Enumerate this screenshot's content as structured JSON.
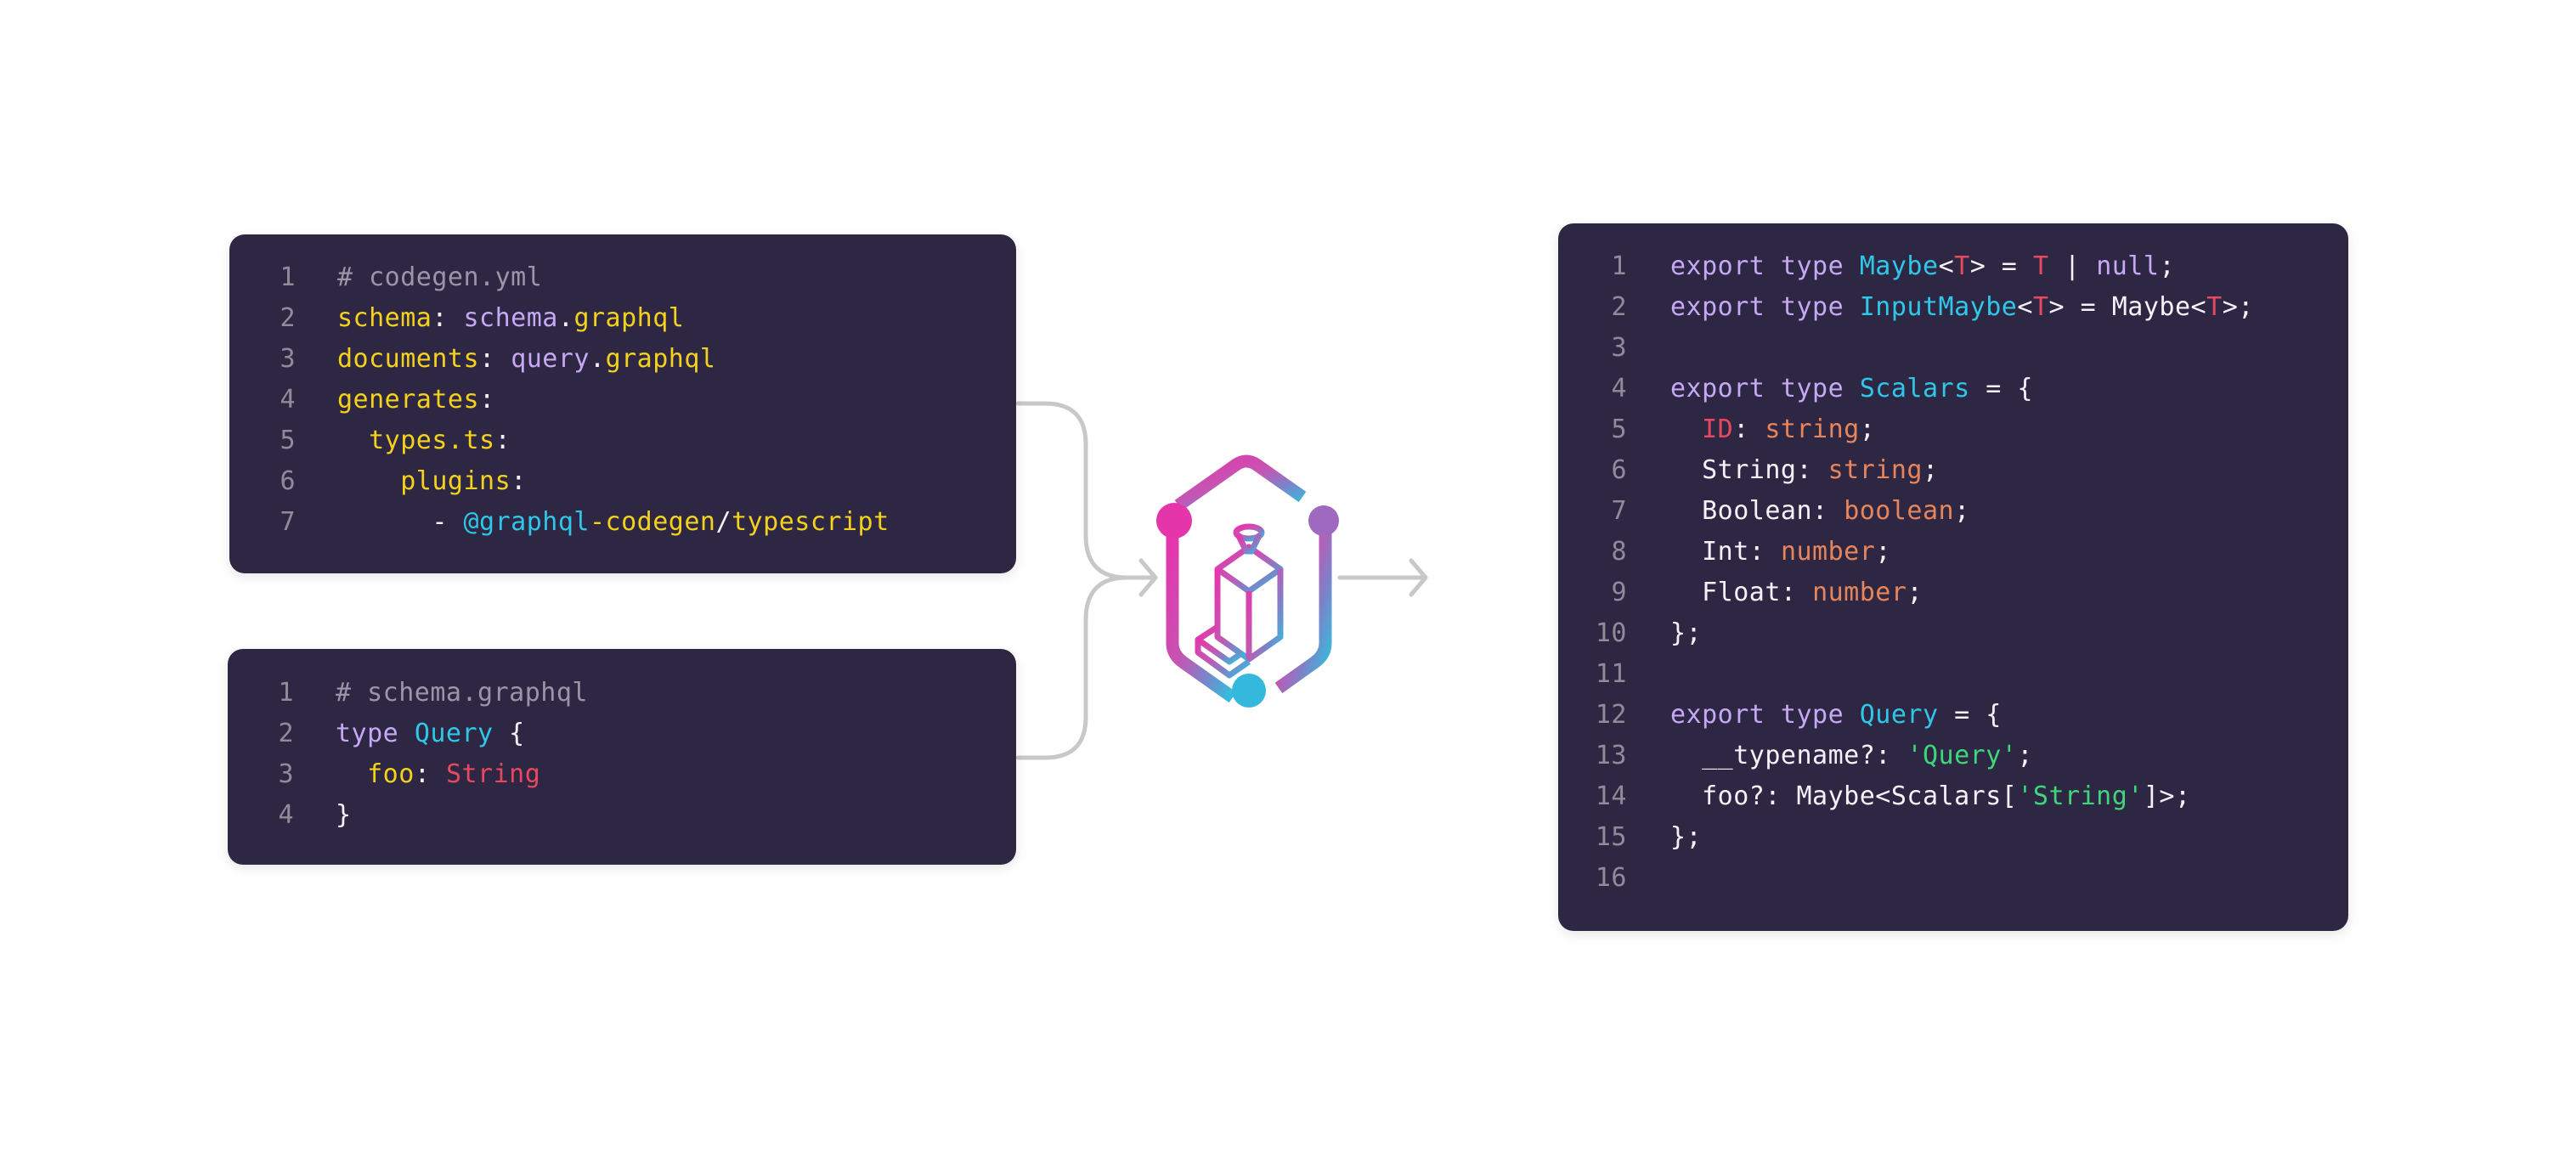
{
  "colors": {
    "panel_bg": "#2e2744",
    "line_number": "#8f8c99",
    "comment": "#9a96a8",
    "yaml_key": "#f4d21c",
    "keyword": "#c6a8f4",
    "type_name": "#2fc7e8",
    "scalar_red": "#e8485f",
    "ts_primitive": "#e8845a",
    "string_literal": "#3ed67a",
    "plain": "#f4f2f8",
    "connector": "#c8c8c8",
    "logo_pink": "#e535ab",
    "logo_purple": "#9f69c0",
    "logo_cyan": "#2ec2e0"
  },
  "panels": {
    "codegen_config": {
      "lines": [
        {
          "n": "1",
          "tokens": [
            {
              "t": "# codegen.yml",
              "c": "comment"
            }
          ]
        },
        {
          "n": "2",
          "tokens": [
            {
              "t": "schema",
              "c": "key"
            },
            {
              "t": ": ",
              "c": "white"
            },
            {
              "t": "schema",
              "c": "purple"
            },
            {
              "t": ".",
              "c": "white"
            },
            {
              "t": "graphql",
              "c": "yellow"
            }
          ]
        },
        {
          "n": "3",
          "tokens": [
            {
              "t": "documents",
              "c": "key"
            },
            {
              "t": ": ",
              "c": "white"
            },
            {
              "t": "query",
              "c": "purple"
            },
            {
              "t": ".",
              "c": "white"
            },
            {
              "t": "graphql",
              "c": "yellow"
            }
          ]
        },
        {
          "n": "4",
          "tokens": [
            {
              "t": "generates",
              "c": "key"
            },
            {
              "t": ":",
              "c": "white"
            }
          ]
        },
        {
          "n": "5",
          "tokens": [
            {
              "t": "  types.ts",
              "c": "key"
            },
            {
              "t": ":",
              "c": "white"
            }
          ]
        },
        {
          "n": "6",
          "tokens": [
            {
              "t": "    plugins",
              "c": "key"
            },
            {
              "t": ":",
              "c": "white"
            }
          ]
        },
        {
          "n": "7",
          "tokens": [
            {
              "t": "      - ",
              "c": "white"
            },
            {
              "t": "@graphql",
              "c": "cyan"
            },
            {
              "t": "-codegen",
              "c": "yellow"
            },
            {
              "t": "/",
              "c": "white"
            },
            {
              "t": "typescript",
              "c": "yellow"
            }
          ]
        }
      ]
    },
    "schema": {
      "lines": [
        {
          "n": "1",
          "tokens": [
            {
              "t": "# schema.graphql",
              "c": "comment"
            }
          ]
        },
        {
          "n": "2",
          "tokens": [
            {
              "t": "type ",
              "c": "purple"
            },
            {
              "t": "Query",
              "c": "cyan"
            },
            {
              "t": " {",
              "c": "white"
            }
          ]
        },
        {
          "n": "3",
          "tokens": [
            {
              "t": "  foo",
              "c": "key"
            },
            {
              "t": ": ",
              "c": "white"
            },
            {
              "t": "String",
              "c": "red"
            }
          ]
        },
        {
          "n": "4",
          "tokens": [
            {
              "t": "}",
              "c": "white"
            }
          ]
        }
      ]
    },
    "output_types": {
      "lines": [
        {
          "n": "1",
          "tokens": [
            {
              "t": "export type ",
              "c": "purple"
            },
            {
              "t": "Maybe",
              "c": "cyan"
            },
            {
              "t": "<",
              "c": "white"
            },
            {
              "t": "T",
              "c": "red"
            },
            {
              "t": "> = ",
              "c": "white"
            },
            {
              "t": "T",
              "c": "red"
            },
            {
              "t": " | ",
              "c": "white"
            },
            {
              "t": "null",
              "c": "purple"
            },
            {
              "t": ";",
              "c": "white"
            }
          ]
        },
        {
          "n": "2",
          "tokens": [
            {
              "t": "export type ",
              "c": "purple"
            },
            {
              "t": "InputMaybe",
              "c": "cyan"
            },
            {
              "t": "<",
              "c": "white"
            },
            {
              "t": "T",
              "c": "red"
            },
            {
              "t": "> = Maybe<",
              "c": "white"
            },
            {
              "t": "T",
              "c": "red"
            },
            {
              "t": ">;",
              "c": "white"
            }
          ]
        },
        {
          "n": "3",
          "tokens": []
        },
        {
          "n": "4",
          "tokens": [
            {
              "t": "export type ",
              "c": "purple"
            },
            {
              "t": "Scalars",
              "c": "cyan"
            },
            {
              "t": " = {",
              "c": "white"
            }
          ]
        },
        {
          "n": "5",
          "tokens": [
            {
              "t": "  ",
              "c": "white"
            },
            {
              "t": "ID",
              "c": "red"
            },
            {
              "t": ": ",
              "c": "white"
            },
            {
              "t": "string",
              "c": "orange"
            },
            {
              "t": ";",
              "c": "white"
            }
          ]
        },
        {
          "n": "6",
          "tokens": [
            {
              "t": "  String: ",
              "c": "white"
            },
            {
              "t": "string",
              "c": "orange"
            },
            {
              "t": ";",
              "c": "white"
            }
          ]
        },
        {
          "n": "7",
          "tokens": [
            {
              "t": "  Boolean: ",
              "c": "white"
            },
            {
              "t": "boolean",
              "c": "orange"
            },
            {
              "t": ";",
              "c": "white"
            }
          ]
        },
        {
          "n": "8",
          "tokens": [
            {
              "t": "  Int: ",
              "c": "white"
            },
            {
              "t": "number",
              "c": "orange"
            },
            {
              "t": ";",
              "c": "white"
            }
          ]
        },
        {
          "n": "9",
          "tokens": [
            {
              "t": "  Float: ",
              "c": "white"
            },
            {
              "t": "number",
              "c": "orange"
            },
            {
              "t": ";",
              "c": "white"
            }
          ]
        },
        {
          "n": "10",
          "tokens": [
            {
              "t": "};",
              "c": "white"
            }
          ]
        },
        {
          "n": "11",
          "tokens": []
        },
        {
          "n": "12",
          "tokens": [
            {
              "t": "export type ",
              "c": "purple"
            },
            {
              "t": "Query",
              "c": "cyan"
            },
            {
              "t": " = {",
              "c": "white"
            }
          ]
        },
        {
          "n": "13",
          "tokens": [
            {
              "t": "  __typename?: ",
              "c": "white"
            },
            {
              "t": "'Query'",
              "c": "green"
            },
            {
              "t": ";",
              "c": "white"
            }
          ]
        },
        {
          "n": "14",
          "tokens": [
            {
              "t": "  foo?: Maybe<Scalars[",
              "c": "white"
            },
            {
              "t": "'String'",
              "c": "green"
            },
            {
              "t": "]>;",
              "c": "white"
            }
          ]
        },
        {
          "n": "15",
          "tokens": [
            {
              "t": "};",
              "c": "white"
            }
          ]
        },
        {
          "n": "16",
          "tokens": []
        }
      ]
    }
  },
  "logo": {
    "name": "graphql-codegen-logo"
  }
}
